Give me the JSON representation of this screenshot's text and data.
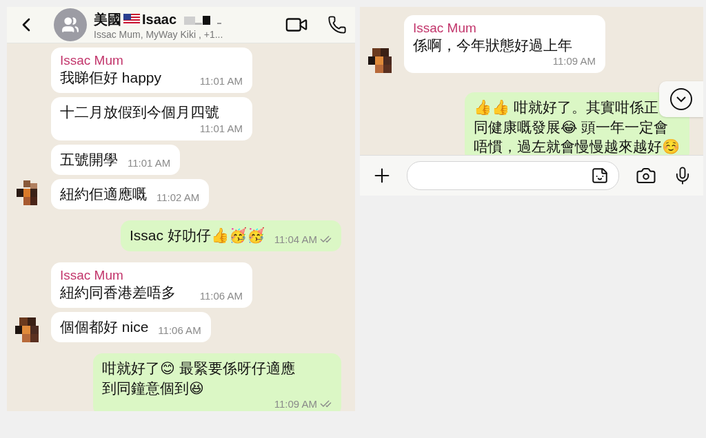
{
  "panels": [
    {
      "header": {
        "title_before_flag": "美國",
        "title_after_flag": "Isaac",
        "subtitle": "Issac Mum, MyWay Kiki , +1..."
      },
      "messages": [
        {
          "kind": "incoming",
          "sender": "Issac Mum",
          "avatar": false,
          "lines": [
            "我睇佢好 happy"
          ],
          "time": "11:01 AM"
        },
        {
          "kind": "incoming",
          "avatar": false,
          "lines": [
            "十二月放假到今個月四號"
          ],
          "time": "11:01 AM"
        },
        {
          "kind": "incoming",
          "avatar": false,
          "lines": [
            "五號開學"
          ],
          "time": "11:01 AM"
        },
        {
          "kind": "incoming",
          "avatar": true,
          "lines": [
            "紐約佢適應嘅"
          ],
          "time": "11:02 AM"
        },
        {
          "kind": "outgoing",
          "delivered": true,
          "lines": [
            "Issac 好叻仔👍🥳🥳"
          ],
          "time": "11:04 AM"
        },
        {
          "kind": "incoming",
          "sender": "Issac Mum",
          "avatar": false,
          "lines": [
            "紐約同香港差唔多"
          ],
          "time": "11:06 AM"
        },
        {
          "kind": "incoming",
          "avatar": true,
          "lines": [
            "個個都好 nice"
          ],
          "time": "11:06 AM"
        },
        {
          "kind": "outgoing",
          "delivered": true,
          "lines": [
            "咁就好了😊 最緊要係呀仔適應",
            "到同鐘意個到😆"
          ],
          "time": "11:09 AM"
        }
      ]
    },
    {
      "messages": [
        {
          "kind": "incoming",
          "sender": "Issac Mum",
          "avatar": true,
          "lines": [
            "係啊，今年狀態好過上年"
          ],
          "time": "11:09 AM"
        },
        {
          "kind": "outgoing",
          "lines": [
            "👍👍 咁就好了。其實咁係正",
            "同健康嘅發展😂 頭一年一定會",
            "唔慣，過左就會慢慢越來越好☺️"
          ]
        }
      ],
      "scroll_down_button": true
    }
  ]
}
